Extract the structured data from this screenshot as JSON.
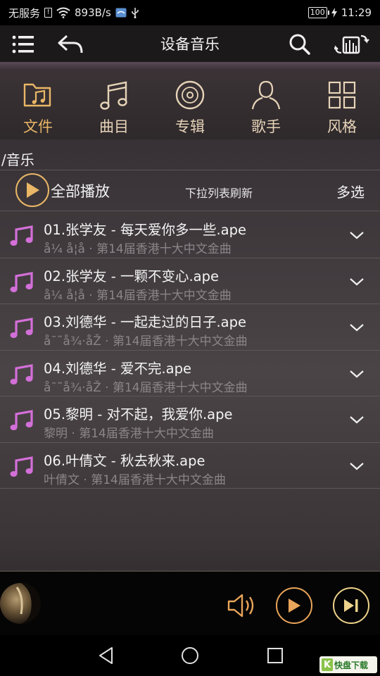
{
  "status_bar": {
    "carrier": "无服务",
    "speed": "893B/s",
    "battery": "100",
    "time": "11:29"
  },
  "header": {
    "title": "设备音乐"
  },
  "tabs": [
    {
      "label": "文件",
      "icon": "folder-music-icon",
      "active": true
    },
    {
      "label": "曲目",
      "icon": "music-note-icon",
      "active": false
    },
    {
      "label": "专辑",
      "icon": "disc-icon",
      "active": false
    },
    {
      "label": "歌手",
      "icon": "person-icon",
      "active": false
    },
    {
      "label": "风格",
      "icon": "grid-icon",
      "active": false
    }
  ],
  "path": "/音乐",
  "actions": {
    "play_all": "全部播放",
    "refresh_hint": "下拉列表刷新",
    "multi_select": "多选"
  },
  "songs": [
    {
      "title": "01.张学友 - 每天爱你多一些.ape",
      "subtitle": "å¼ å­¦å · 第14届香港十大中文金曲"
    },
    {
      "title": "02.张学友 - 一颗不变心.ape",
      "subtitle": "å¼ å­¦å · 第14届香港十大中文金曲"
    },
    {
      "title": "03.刘德华 - 一起走过的日子.ape",
      "subtitle": "å¯˜å¾·åŽ · 第14届香港十大中文金曲"
    },
    {
      "title": "04.刘德华 - 爱不完.ape",
      "subtitle": "å¯˜å¾·åŽ · 第14届香港十大中文金曲"
    },
    {
      "title": "05.黎明 - 对不起，我爱你.ape",
      "subtitle": "黎明 · 第14届香港十大中文金曲"
    },
    {
      "title": "06.叶倩文 - 秋去秋来.ape",
      "subtitle": "叶倩文 · 第14届香港十大中文金曲"
    }
  ],
  "watermark": {
    "brand": "快盘下载"
  },
  "colors": {
    "accent": "#e9b766",
    "note": "#d36fd8"
  }
}
